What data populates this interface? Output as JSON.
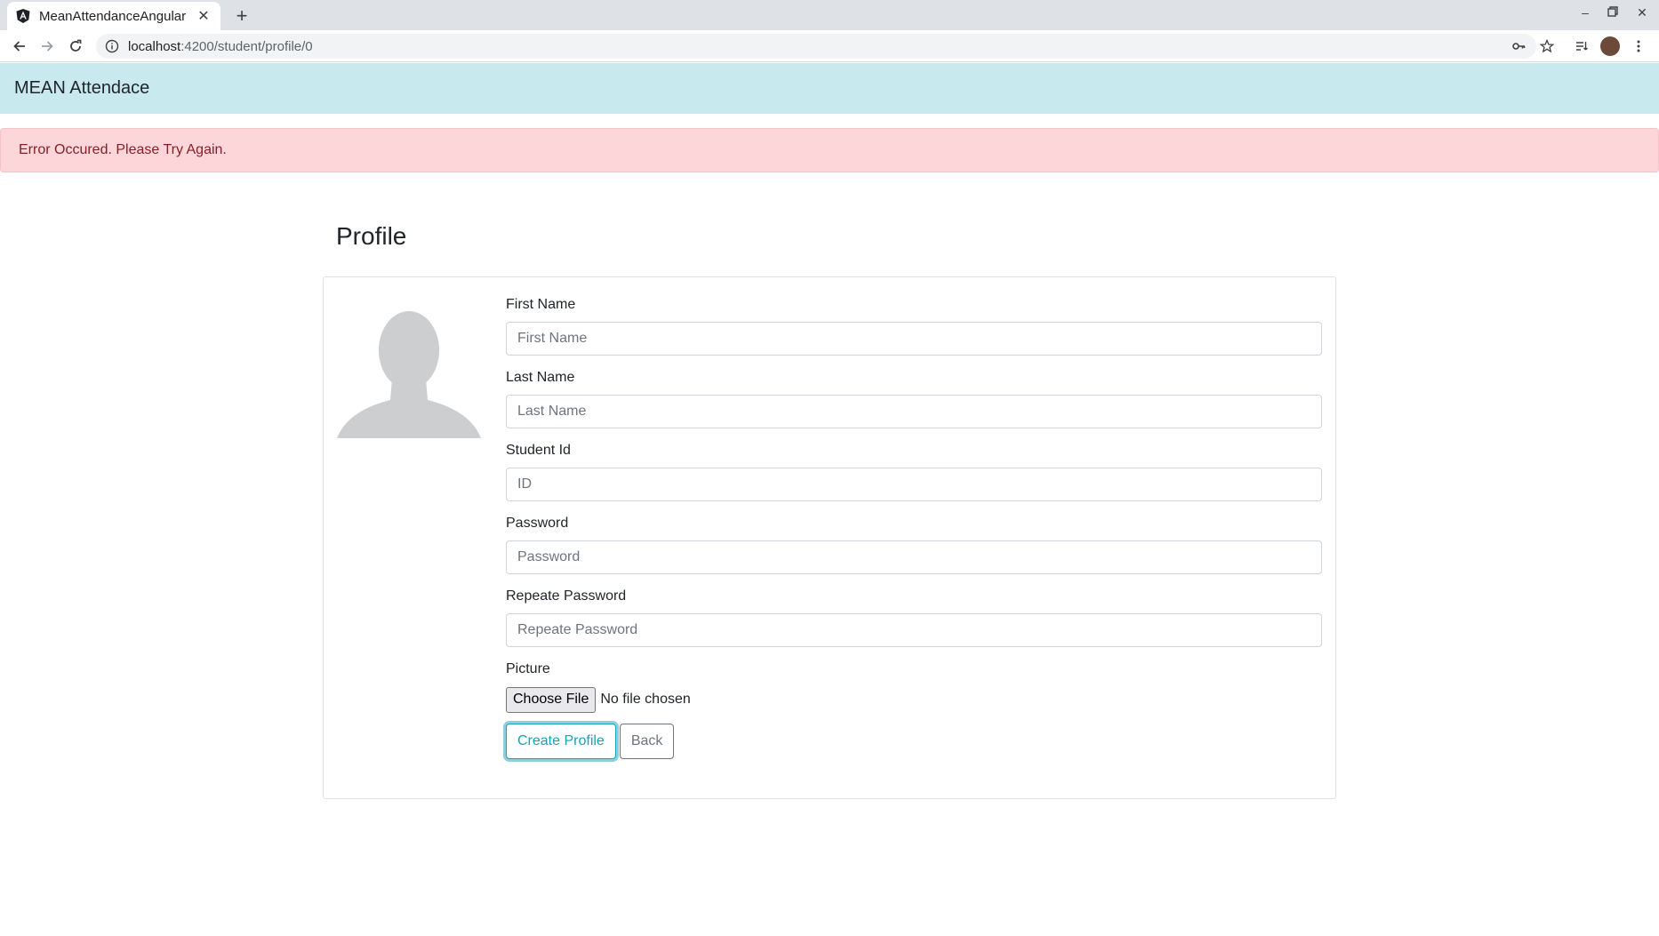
{
  "browser": {
    "tab_title": "MeanAttendanceAngular",
    "tab_close": "✕",
    "new_tab": "+",
    "url_host": "localhost",
    "url_path": ":4200/student/profile/0",
    "window_controls": {
      "minimize": "–",
      "restore": "▫",
      "close": "✕"
    }
  },
  "app": {
    "brand": "MEAN Attendace"
  },
  "alert": {
    "message": "Error Occured. Please Try Again.",
    "color": "#842029"
  },
  "page": {
    "title": "Profile"
  },
  "form": {
    "first_name": {
      "label": "First Name",
      "placeholder": "First Name",
      "value": ""
    },
    "last_name": {
      "label": "Last Name",
      "placeholder": "Last Name",
      "value": ""
    },
    "student_id": {
      "label": "Student Id",
      "placeholder": "ID",
      "value": ""
    },
    "password": {
      "label": "Password",
      "placeholder": "Password",
      "value": ""
    },
    "repeat_password": {
      "label": "Repeate Password",
      "placeholder": "Repeate Password",
      "value": ""
    },
    "picture": {
      "label": "Picture",
      "button": "Choose File",
      "status": "No file chosen"
    },
    "submit_label": "Create Profile",
    "back_label": "Back"
  },
  "colors": {
    "navbar_bg": "#c8eaef",
    "alert_bg": "#fdd6da",
    "primary_outline": "#17a2b8",
    "secondary_outline": "#6c757d"
  }
}
